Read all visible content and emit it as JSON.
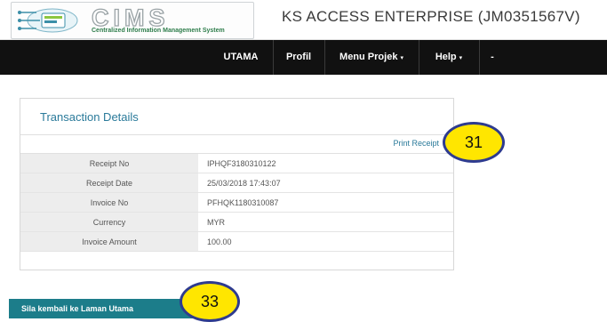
{
  "header": {
    "logo_text": "CIMS",
    "logo_subtitle": "Centralized Information Management System",
    "company": "KS ACCESS ENTERPRISE (JM0351567V)"
  },
  "nav": {
    "items": [
      {
        "label": "UTAMA"
      },
      {
        "label": "Profil"
      },
      {
        "label": "Menu Projek",
        "caret": "▾"
      },
      {
        "label": "Help",
        "caret": "▾"
      },
      {
        "label": "-"
      }
    ]
  },
  "panel": {
    "title": "Transaction Details",
    "print_link": "Print Receipt",
    "rows": [
      {
        "label": "Receipt No",
        "value": "IPHQF3180310122"
      },
      {
        "label": "Receipt Date",
        "value": "25/03/2018 17:43:07"
      },
      {
        "label": "Invoice No",
        "value": "PFHQK1180310087"
      },
      {
        "label": "Currency",
        "value": "MYR"
      },
      {
        "label": "Invoice Amount",
        "value": "100.00"
      }
    ]
  },
  "back_button": "Sila kembali ke Laman Utama",
  "callouts": {
    "print": "31",
    "back": "33"
  },
  "colors": {
    "navbar": "#111111",
    "accent_text": "#2a7a9a",
    "button": "#1c7d8a",
    "callout_fill": "#ffe600",
    "callout_border": "#2e3b8f"
  }
}
